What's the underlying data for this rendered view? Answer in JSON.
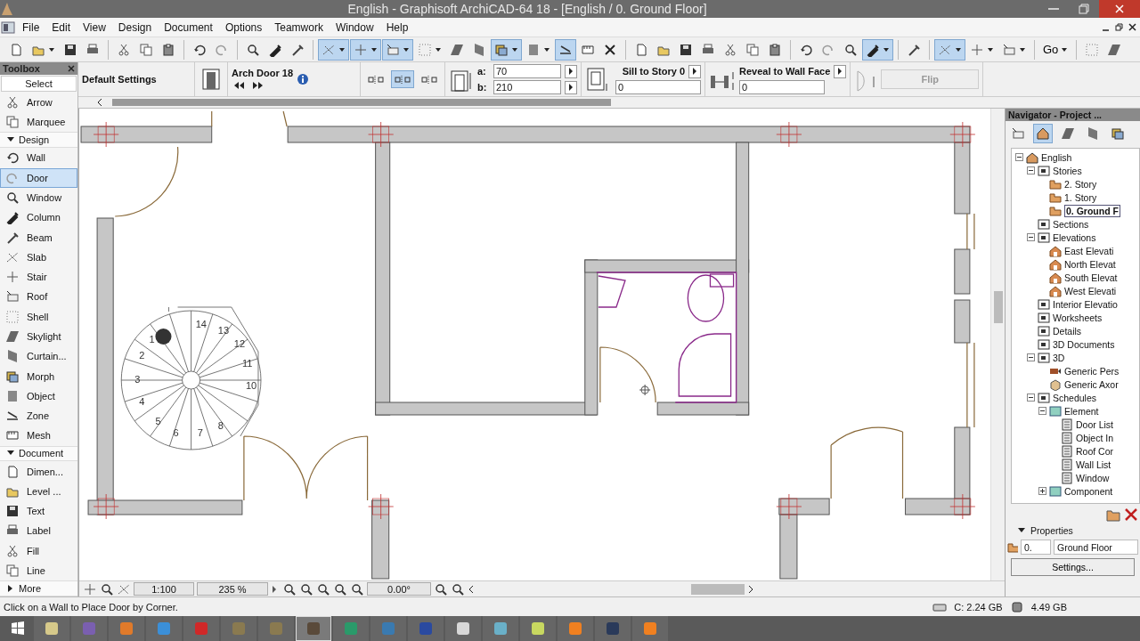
{
  "window": {
    "title": "English - Graphisoft ArchiCAD-64 18 - [English / 0. Ground Floor]"
  },
  "menu": [
    "File",
    "Edit",
    "View",
    "Design",
    "Document",
    "Options",
    "Teamwork",
    "Window",
    "Help"
  ],
  "toolbar": [
    {
      "kind": "button",
      "selected": false,
      "dropdown": false
    },
    {
      "kind": "button",
      "selected": false,
      "dropdown": true
    },
    {
      "kind": "button",
      "selected": false,
      "dropdown": false
    },
    {
      "kind": "button",
      "selected": false,
      "dropdown": false
    },
    {
      "kind": "separator"
    },
    {
      "kind": "button",
      "selected": false,
      "dropdown": false
    },
    {
      "kind": "button",
      "selected": false,
      "dropdown": false
    },
    {
      "kind": "button",
      "selected": false,
      "dropdown": false
    },
    {
      "kind": "separator"
    },
    {
      "kind": "button",
      "selected": false,
      "dropdown": false
    },
    {
      "kind": "button",
      "selected": false,
      "dropdown": false
    },
    {
      "kind": "separator"
    },
    {
      "kind": "button",
      "selected": false,
      "dropdown": false
    },
    {
      "kind": "button",
      "selected": false,
      "dropdown": false
    },
    {
      "kind": "button",
      "selected": false,
      "dropdown": false
    },
    {
      "kind": "separator"
    },
    {
      "kind": "button",
      "selected": true,
      "dropdown": true
    },
    {
      "kind": "button",
      "selected": true,
      "dropdown": true
    },
    {
      "kind": "button",
      "selected": true,
      "dropdown": true
    },
    {
      "kind": "button",
      "selected": false,
      "dropdown": true
    },
    {
      "kind": "button",
      "selected": false,
      "dropdown": false
    },
    {
      "kind": "button",
      "selected": false,
      "dropdown": false
    },
    {
      "kind": "button",
      "selected": true,
      "dropdown": true
    },
    {
      "kind": "button",
      "selected": false,
      "dropdown": true
    },
    {
      "kind": "button",
      "selected": true,
      "dropdown": false
    },
    {
      "kind": "button",
      "selected": false,
      "dropdown": false
    },
    {
      "kind": "button",
      "selected": false,
      "dropdown": false
    },
    {
      "kind": "separator"
    },
    {
      "kind": "button",
      "selected": false,
      "dropdown": false
    },
    {
      "kind": "button",
      "selected": false,
      "dropdown": false
    },
    {
      "kind": "button",
      "selected": false,
      "dropdown": false
    },
    {
      "kind": "button",
      "selected": false,
      "dropdown": false
    },
    {
      "kind": "button",
      "selected": false,
      "dropdown": false
    },
    {
      "kind": "button",
      "selected": false,
      "dropdown": false
    },
    {
      "kind": "button",
      "selected": false,
      "dropdown": false
    },
    {
      "kind": "separator"
    },
    {
      "kind": "button",
      "selected": false,
      "dropdown": false
    },
    {
      "kind": "button",
      "selected": false,
      "dropdown": false
    },
    {
      "kind": "button",
      "selected": false,
      "dropdown": false
    },
    {
      "kind": "button",
      "selected": true,
      "dropdown": true
    },
    {
      "kind": "separator"
    },
    {
      "kind": "button",
      "selected": false,
      "dropdown": false
    },
    {
      "kind": "separator"
    },
    {
      "kind": "button",
      "selected": true,
      "dropdown": true
    },
    {
      "kind": "button",
      "selected": false,
      "dropdown": true
    },
    {
      "kind": "button",
      "selected": false,
      "dropdown": true
    },
    {
      "kind": "separator"
    },
    {
      "kind": "text",
      "label": "Go",
      "selected": false,
      "dropdown": true
    },
    {
      "kind": "separator"
    },
    {
      "kind": "button",
      "selected": false,
      "dropdown": false
    },
    {
      "kind": "button",
      "selected": false,
      "dropdown": false
    }
  ],
  "toolbox": {
    "title": "Toolbox",
    "items": [
      {
        "kind": "header",
        "label": "Select"
      },
      {
        "kind": "tool",
        "label": "Arrow",
        "selected": false
      },
      {
        "kind": "tool",
        "label": "Marquee",
        "selected": false
      },
      {
        "kind": "section",
        "label": "Design",
        "expanded": true
      },
      {
        "kind": "tool",
        "label": "Wall",
        "selected": false
      },
      {
        "kind": "tool",
        "label": "Door",
        "selected": true
      },
      {
        "kind": "tool",
        "label": "Window",
        "selected": false
      },
      {
        "kind": "tool",
        "label": "Column",
        "selected": false
      },
      {
        "kind": "tool",
        "label": "Beam",
        "selected": false
      },
      {
        "kind": "tool",
        "label": "Slab",
        "selected": false
      },
      {
        "kind": "tool",
        "label": "Stair",
        "selected": false
      },
      {
        "kind": "tool",
        "label": "Roof",
        "selected": false
      },
      {
        "kind": "tool",
        "label": "Shell",
        "selected": false
      },
      {
        "kind": "tool",
        "label": "Skylight",
        "selected": false
      },
      {
        "kind": "tool",
        "label": "Curtain...",
        "selected": false
      },
      {
        "kind": "tool",
        "label": "Morph",
        "selected": false
      },
      {
        "kind": "tool",
        "label": "Object",
        "selected": false
      },
      {
        "kind": "tool",
        "label": "Zone",
        "selected": false
      },
      {
        "kind": "tool",
        "label": "Mesh",
        "selected": false
      },
      {
        "kind": "section",
        "label": "Document",
        "expanded": true
      },
      {
        "kind": "tool",
        "label": "Dimen...",
        "selected": false
      },
      {
        "kind": "tool",
        "label": "Level ...",
        "selected": false
      },
      {
        "kind": "tool",
        "label": "Text",
        "selected": false
      },
      {
        "kind": "tool",
        "label": "Label",
        "selected": false
      },
      {
        "kind": "tool",
        "label": "Fill",
        "selected": false
      },
      {
        "kind": "tool",
        "label": "Line",
        "selected": false
      },
      {
        "kind": "section",
        "label": "More",
        "expanded": false
      }
    ]
  },
  "infobox": {
    "caption": "Default Settings",
    "element": "Arch Door 18",
    "anchors": [
      {
        "selected": false
      },
      {
        "selected": true
      },
      {
        "selected": false
      }
    ],
    "a_label": "a:",
    "a": "70",
    "b_label": "b:",
    "b": "210",
    "sill_label": "Sill to Story 0",
    "sill": "0",
    "reveal_label": "Reveal to Wall Face",
    "reveal": "0",
    "flip": "Flip",
    "flip_disabled": true
  },
  "plan": {
    "stair_numbers": [
      "14",
      "13",
      "12",
      "11",
      "10",
      "3",
      "4",
      "5",
      "6",
      "7",
      "8",
      "2",
      "1"
    ]
  },
  "view_bar": {
    "scale": "1:100",
    "zoom": "235 %",
    "angle": "0.00°"
  },
  "navigator": {
    "title": "Navigator - Project ...",
    "tree": [
      {
        "label": "English",
        "kind": "project",
        "selected": false,
        "expanded": true,
        "children": [
          {
            "label": "Stories",
            "kind": "group",
            "selected": false,
            "expanded": true,
            "children": [
              {
                "label": "2. Story",
                "kind": "story",
                "selected": false
              },
              {
                "label": "1. Story",
                "kind": "story",
                "selected": false
              },
              {
                "label": "0. Ground F",
                "kind": "story",
                "selected": true
              }
            ]
          },
          {
            "label": "Sections",
            "kind": "group",
            "selected": false
          },
          {
            "label": "Elevations",
            "kind": "group",
            "selected": false,
            "expanded": true,
            "children": [
              {
                "label": "East Elevati",
                "kind": "elevation",
                "selected": false
              },
              {
                "label": "North Elevat",
                "kind": "elevation",
                "selected": false
              },
              {
                "label": "South Elevat",
                "kind": "elevation",
                "selected": false
              },
              {
                "label": "West Elevati",
                "kind": "elevation",
                "selected": false
              }
            ]
          },
          {
            "label": "Interior Elevatio",
            "kind": "group",
            "selected": false
          },
          {
            "label": "Worksheets",
            "kind": "group",
            "selected": false
          },
          {
            "label": "Details",
            "kind": "group",
            "selected": false
          },
          {
            "label": "3D Documents",
            "kind": "group",
            "selected": false
          },
          {
            "label": "3D",
            "kind": "group",
            "selected": false,
            "expanded": true,
            "children": [
              {
                "label": "Generic Pers",
                "kind": "camera",
                "selected": false
              },
              {
                "label": "Generic Axor",
                "kind": "box",
                "selected": false
              }
            ]
          },
          {
            "label": "Schedules",
            "kind": "group",
            "selected": false,
            "expanded": true,
            "children": [
              {
                "label": "Element",
                "kind": "schedule",
                "selected": false,
                "expanded": true,
                "children": [
                  {
                    "label": "Door List",
                    "kind": "list",
                    "selected": false
                  },
                  {
                    "label": "Object In",
                    "kind": "list",
                    "selected": false
                  },
                  {
                    "label": "Roof Cor",
                    "kind": "list",
                    "selected": false
                  },
                  {
                    "label": "Wall List",
                    "kind": "list",
                    "selected": false
                  },
                  {
                    "label": "Window",
                    "kind": "list",
                    "selected": false
                  }
                ]
              },
              {
                "label": "Component",
                "kind": "schedule",
                "selected": false,
                "expanded": false
              }
            ]
          }
        ]
      }
    ],
    "properties_label": "Properties",
    "story_number": "0.",
    "story_name": "Ground Floor",
    "settings": "Settings..."
  },
  "status_bar": {
    "message": "Click on a Wall to Place Door by Corner.",
    "disk": "C: 2.24 GB",
    "memory": "4.49 GB"
  },
  "taskbar": {
    "apps": [
      {
        "color": "#d6c98a",
        "selected": false
      },
      {
        "color": "#7a5fb0",
        "selected": false
      },
      {
        "color": "#e07a2a",
        "selected": false
      },
      {
        "color": "#3b8fd8",
        "selected": false
      },
      {
        "color": "#d02828",
        "selected": false
      },
      {
        "color": "#8a7a50",
        "selected": false
      },
      {
        "color": "#8a7a50",
        "selected": false
      },
      {
        "color": "#5a4a3a",
        "selected": true
      },
      {
        "color": "#2a9a6a",
        "selected": false
      },
      {
        "color": "#3a7ab0",
        "selected": false
      },
      {
        "color": "#2a4aa0",
        "selected": false
      },
      {
        "color": "#d8d8d8",
        "selected": false
      },
      {
        "color": "#6ab0c8",
        "selected": false
      },
      {
        "color": "#c8d860",
        "selected": false
      },
      {
        "color": "#f08020",
        "selected": false
      },
      {
        "color": "#2a3a5a",
        "selected": false
      },
      {
        "color": "#f08020",
        "selected": false
      }
    ]
  }
}
